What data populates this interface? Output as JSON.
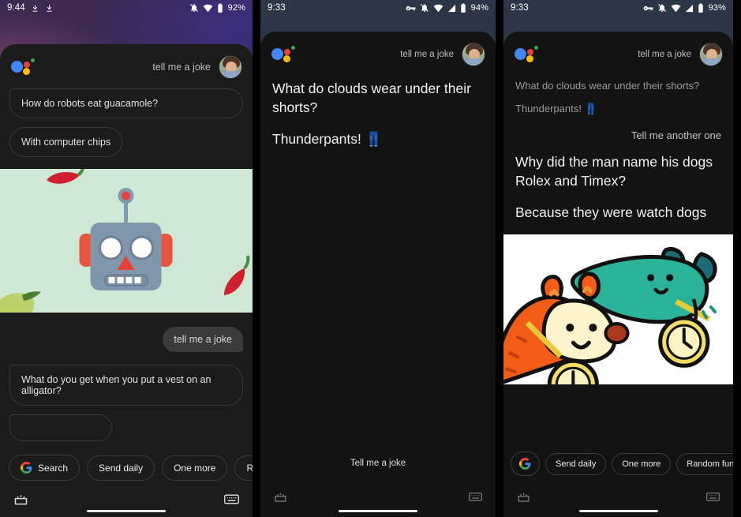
{
  "app": {
    "name": "Google Assistant",
    "logo_name": "google-assistant-logo"
  },
  "panels": [
    {
      "id": "panel-1",
      "status_bar": {
        "clock": "9:44",
        "battery_percent": "92%",
        "icons_left": [
          "download-icon",
          "download-icon"
        ],
        "icons_right": [
          "bell-muted-icon",
          "wifi-icon",
          "battery-icon"
        ]
      },
      "header": {
        "query": "tell me a joke",
        "avatar_name": "user-avatar"
      },
      "bubbles": [
        "How do robots eat guacamole?",
        "With computer chips"
      ],
      "card_image": {
        "name": "robot-guacamole-illustration",
        "background": "#cfe8d5",
        "subjects": [
          "robot-face-emoji",
          "chili-pepper-emoji",
          "avocado-emoji"
        ]
      },
      "sent_message": "tell me a joke",
      "followup_bubble": "What do you get when you put a vest on an alligator?",
      "chips": [
        "Search",
        "Send daily",
        "One more",
        "Random"
      ],
      "bottom_nav": [
        "explore-icon",
        "microphone-icon",
        "keyboard-icon"
      ]
    },
    {
      "id": "panel-2",
      "status_bar": {
        "clock": "9:33",
        "battery_percent": "94%",
        "icons_right": [
          "vpn-key-icon",
          "bell-muted-icon",
          "wifi-icon",
          "signal-icon",
          "battery-icon"
        ]
      },
      "header": {
        "query": "tell me a joke",
        "avatar_name": "user-avatar"
      },
      "answer_lines": [
        "What do clouds wear under their shorts?",
        "Thunderpants! 👖"
      ],
      "listening_hint": "Tell me a joke",
      "bottom_nav": [
        "explore-icon",
        "keyboard-icon"
      ]
    },
    {
      "id": "panel-3",
      "status_bar": {
        "clock": "9:33",
        "battery_percent": "93%",
        "icons_right": [
          "vpn-key-icon",
          "bell-muted-icon",
          "wifi-icon",
          "signal-icon",
          "battery-icon"
        ]
      },
      "header": {
        "query": "tell me a joke",
        "avatar_name": "user-avatar"
      },
      "previous_lines": [
        "What do clouds wear under their shorts?",
        "Thunderpants! 👖"
      ],
      "new_request": "Tell me another one",
      "answer_lines": [
        "Why did the man name his dogs Rolex and Timex?",
        "Because they were watch dogs"
      ],
      "card_image": {
        "name": "watch-dogs-illustration",
        "background": "#ffffff",
        "subjects": [
          "orange-dog",
          "teal-dog",
          "watch-medal"
        ]
      },
      "chips": [
        "Send daily",
        "One more",
        "Random fun"
      ],
      "google_chip_icon": "google-g-icon",
      "bottom_nav": [
        "explore-icon",
        "microphone-icon",
        "keyboard-icon"
      ]
    }
  ],
  "colors": {
    "google_blue": "#4285F4",
    "google_red": "#EA4335",
    "google_yellow": "#FBBC05",
    "google_green": "#34A853",
    "sheet_bg": "#1b1b1b",
    "sheet_bg_dark": "#131313"
  }
}
